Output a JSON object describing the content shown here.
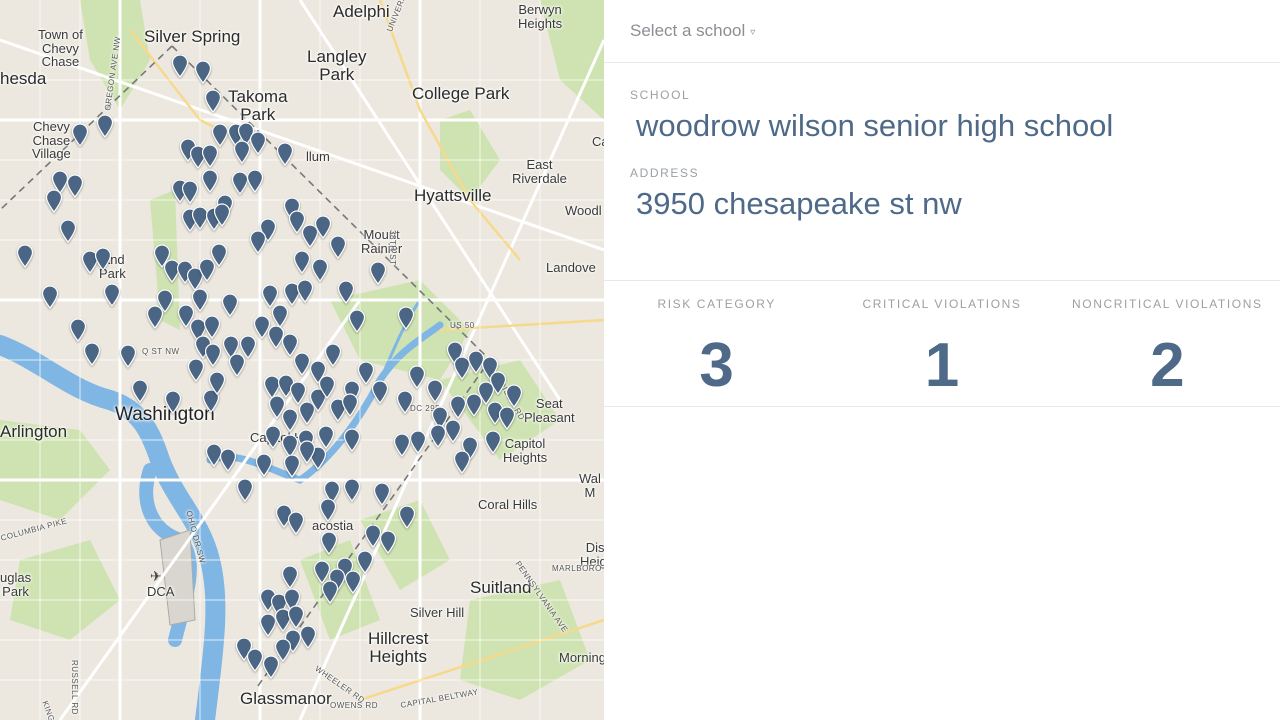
{
  "map": {
    "places": [
      {
        "name": "Adelphi",
        "cls": "city"
      },
      {
        "name": "Town of\nChevy\nChase",
        "cls": "small"
      },
      {
        "name": "Silver Spring",
        "cls": "city"
      },
      {
        "name": "Langley\nPark",
        "cls": "city"
      },
      {
        "name": "Berwyn\nHeights",
        "cls": "small"
      },
      {
        "name": "hesda",
        "cls": "city"
      },
      {
        "name": "Takoma\nPark",
        "cls": "city"
      },
      {
        "name": "College Park",
        "cls": "city"
      },
      {
        "name": "Chevy\nChase\nVillage",
        "cls": "small"
      },
      {
        "name": "East\nRiverdale",
        "cls": "small"
      },
      {
        "name": "Hyattsville",
        "cls": "city"
      },
      {
        "name": "Mount\nRainier",
        "cls": "small"
      },
      {
        "name": "Woodl",
        "cls": "small"
      },
      {
        "name": "Landove",
        "cls": "small"
      },
      {
        "name": "Washington",
        "cls": "major"
      },
      {
        "name": "Arlington",
        "cls": "city"
      },
      {
        "name": "Seat\nPleasant",
        "cls": "small"
      },
      {
        "name": "Capitol\nHeights",
        "cls": "small"
      },
      {
        "name": "Wal\nM",
        "cls": "small"
      },
      {
        "name": "Coral Hills",
        "cls": "small"
      },
      {
        "name": "Dist\nHeigh",
        "cls": "small"
      },
      {
        "name": "Suitland",
        "cls": "city"
      },
      {
        "name": "uglas\nPark",
        "cls": "small"
      },
      {
        "name": "DCA",
        "cls": "small"
      },
      {
        "name": "Silver Hill",
        "cls": "small"
      },
      {
        "name": "Hillcrest\nHeights",
        "cls": "city"
      },
      {
        "name": "Morning",
        "cls": "small"
      },
      {
        "name": "Glassmanor",
        "cls": "city"
      },
      {
        "name": "Ca",
        "cls": "small"
      },
      {
        "name": "Capitol Hi",
        "cls": "small"
      },
      {
        "name": "acostia",
        "cls": "small"
      },
      {
        "name": "llum",
        "cls": "small"
      },
      {
        "name": "land\nPark",
        "cls": "small"
      }
    ],
    "roads": [
      "UNIVERSITY BLVD E",
      "OREGON AVE NW",
      "US 50",
      "DC 295",
      "ADDISON RD",
      "MARLBORO",
      "PENNSYLVANIA AVE",
      "OHIO DR SW",
      "COLUMBIA PIKE",
      "WHEELER RD",
      "OWENS RD",
      "CAPITAL BELTWAY",
      "RUSSELL RD",
      "KING ST",
      "Q ST NW",
      "38TH ST"
    ],
    "pin_color": "#4b6584"
  },
  "panel": {
    "selector": {
      "label": "Select a school",
      "caret": "▿"
    },
    "school": {
      "label": "SCHOOL",
      "value": "woodrow wilson senior high school"
    },
    "address": {
      "label": "ADDRESS",
      "value": "3950 chesapeake st nw"
    },
    "stats": [
      {
        "label": "RISK CATEGORY",
        "value": "3"
      },
      {
        "label": "CRITICAL VIOLATIONS",
        "value": "1"
      },
      {
        "label": "NONCRITICAL VIOLATIONS",
        "value": "2"
      }
    ]
  }
}
